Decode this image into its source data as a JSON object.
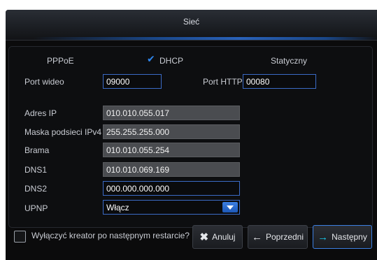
{
  "window": {
    "title": "Sieć"
  },
  "modes": {
    "pppoe": "PPPoE",
    "dhcp": "DHCP",
    "static": "Statyczny",
    "selected": "dhcp",
    "check_icon": "check-icon"
  },
  "ports": {
    "video_label": "Port wideo",
    "video_value": "09000",
    "http_label": "Port HTTP",
    "http_value": "00080"
  },
  "fields": {
    "ip_label": "Adres IP",
    "ip_value": "010.010.055.017",
    "mask_label": "Maska podsieci IPv4",
    "mask_value": "255.255.255.000",
    "gateway_label": "Brama",
    "gateway_value": "010.010.055.254",
    "dns1_label": "DNS1",
    "dns1_value": "010.010.069.169",
    "dns2_label": "DNS2",
    "dns2_value": "000.000.000.000",
    "upnp_label": "UPNP",
    "upnp_value": "Włącz"
  },
  "footer": {
    "checkbox_label": "Wyłączyć kreator po następnym restarcie?",
    "checkbox_checked": false,
    "cancel_label": "Anuluj",
    "back_label": "Poprzedni",
    "next_label": "Następny"
  },
  "colors": {
    "accent": "#3c7fe2",
    "next_arrow": "#19c7e8",
    "readonly_field": "#4a4c50",
    "background": "#0b0b0c"
  }
}
